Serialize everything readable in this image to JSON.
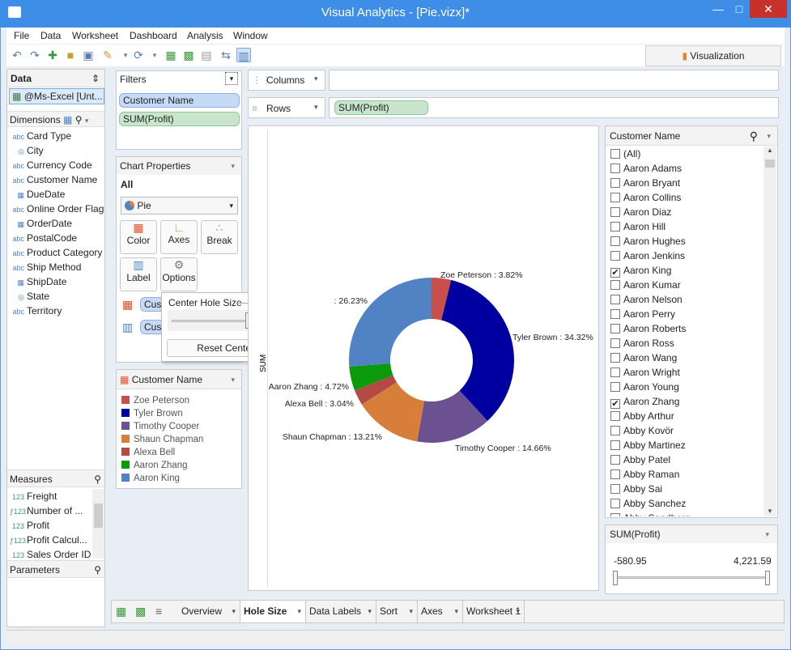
{
  "window": {
    "title": "Visual Analytics - [Pie.vizx]*"
  },
  "menu": [
    "File",
    "Data",
    "Worksheet",
    "Dashboard",
    "Analysis",
    "Window"
  ],
  "toolbar": {
    "viz_tab": "Visualization"
  },
  "data_panel": {
    "header": "Data",
    "source": "@Ms-Excel [Unt...",
    "dimensions_label": "Dimensions",
    "dimensions": [
      {
        "type": "abc",
        "name": "Card Type"
      },
      {
        "type": "globe",
        "name": "City"
      },
      {
        "type": "abc",
        "name": "Currency Code"
      },
      {
        "type": "abc",
        "name": "Customer Name"
      },
      {
        "type": "date",
        "name": "DueDate"
      },
      {
        "type": "abc",
        "name": "Online Order Flag"
      },
      {
        "type": "date",
        "name": "OrderDate"
      },
      {
        "type": "abc",
        "name": "PostalCode"
      },
      {
        "type": "abc",
        "name": "Product Category"
      },
      {
        "type": "abc",
        "name": "Ship Method"
      },
      {
        "type": "date",
        "name": "ShipDate"
      },
      {
        "type": "globe",
        "name": "State"
      },
      {
        "type": "abc",
        "name": "Territory"
      }
    ],
    "measures_label": "Measures",
    "measures": [
      {
        "type": "123",
        "name": "Freight"
      },
      {
        "type": "f123",
        "name": "Number of ..."
      },
      {
        "type": "123",
        "name": "Profit"
      },
      {
        "type": "f123",
        "name": "Profit Calcul..."
      },
      {
        "type": "123",
        "name": "Sales Order ID"
      }
    ],
    "parameters_label": "Parameters"
  },
  "filters": {
    "label": "Filters",
    "items": [
      "Customer Name",
      "SUM(Profit)"
    ]
  },
  "chart_properties": {
    "label": "Chart Properties",
    "scope": "All",
    "chart_type": "Pie",
    "buttons": [
      "Color",
      "Axes",
      "Break",
      "Label",
      "Options"
    ],
    "marks": [
      "Cust",
      "Cust"
    ]
  },
  "popup": {
    "label": "Center Hole Size",
    "reset": "Reset Center Hole Size",
    "value_fraction": 0.5
  },
  "shelves": {
    "columns": "Columns",
    "rows": "Rows",
    "rows_pill": "SUM(Profit)"
  },
  "legend": {
    "title": "Customer Name",
    "items": [
      {
        "name": "Zoe Peterson",
        "color": "#c9504a"
      },
      {
        "name": "Tyler Brown",
        "color": "#0000a0"
      },
      {
        "name": "Timothy Cooper",
        "color": "#6b5191"
      },
      {
        "name": "Shaun Chapman",
        "color": "#d77f3a"
      },
      {
        "name": "Alexa Bell",
        "color": "#b44a45"
      },
      {
        "name": "Aaron Zhang",
        "color": "#0a9a0a"
      },
      {
        "name": "Aaron King",
        "color": "#5183c4"
      }
    ]
  },
  "chart_data": {
    "type": "pie",
    "axis_label": "SUM",
    "slices": [
      {
        "name": "Zoe Peterson",
        "value": 3.82,
        "label": "Zoe Peterson : 3.82%",
        "color": "#c9504a"
      },
      {
        "name": "Tyler Brown",
        "value": 34.32,
        "label": "Tyler Brown : 34.32%",
        "color": "#0000a0"
      },
      {
        "name": "Timothy Cooper",
        "value": 14.66,
        "label": "Timothy Cooper : 14.66%",
        "color": "#6b5191"
      },
      {
        "name": "Shaun Chapman",
        "value": 13.21,
        "label": "Shaun Chapman : 13.21%",
        "color": "#d77f3a"
      },
      {
        "name": "Alexa Bell",
        "value": 3.04,
        "label": "Alexa Bell : 3.04%",
        "color": "#b44a45"
      },
      {
        "name": "Aaron Zhang",
        "value": 4.72,
        "label": "Aaron Zhang : 4.72%",
        "color": "#0a9a0a"
      },
      {
        "name": "Aaron King",
        "value": 26.23,
        "label": ": 26.23%",
        "color": "#5183c4"
      }
    ],
    "hole_fraction": 0.5
  },
  "customer_filter": {
    "title": "Customer Name",
    "items": [
      {
        "name": "(All)",
        "checked": false
      },
      {
        "name": "Aaron Adams",
        "checked": false
      },
      {
        "name": "Aaron Bryant",
        "checked": false
      },
      {
        "name": "Aaron Collins",
        "checked": false
      },
      {
        "name": "Aaron Diaz",
        "checked": false
      },
      {
        "name": "Aaron Hill",
        "checked": false
      },
      {
        "name": "Aaron Hughes",
        "checked": false
      },
      {
        "name": "Aaron Jenkins",
        "checked": false
      },
      {
        "name": "Aaron King",
        "checked": true
      },
      {
        "name": "Aaron Kumar",
        "checked": false
      },
      {
        "name": "Aaron Nelson",
        "checked": false
      },
      {
        "name": "Aaron Perry",
        "checked": false
      },
      {
        "name": "Aaron Roberts",
        "checked": false
      },
      {
        "name": "Aaron Ross",
        "checked": false
      },
      {
        "name": "Aaron Wang",
        "checked": false
      },
      {
        "name": "Aaron Wright",
        "checked": false
      },
      {
        "name": "Aaron Young",
        "checked": false
      },
      {
        "name": "Aaron Zhang",
        "checked": true
      },
      {
        "name": "Abby Arthur",
        "checked": false
      },
      {
        "name": "Abby Kovör",
        "checked": false
      },
      {
        "name": "Abby Martinez",
        "checked": false
      },
      {
        "name": "Abby Patel",
        "checked": false
      },
      {
        "name": "Abby Raman",
        "checked": false
      },
      {
        "name": "Abby Sai",
        "checked": false
      },
      {
        "name": "Abby Sanchez",
        "checked": false
      },
      {
        "name": "Abby Sandberg",
        "checked": false
      }
    ]
  },
  "profit_filter": {
    "title": "SUM(Profit)",
    "min": "-580.95",
    "max": "4,221.59"
  },
  "tabs": [
    "Overview",
    "Hole Size",
    "Data Labels",
    "Sort",
    "Axes",
    "Worksheet 1"
  ],
  "active_tab": "Hole Size"
}
